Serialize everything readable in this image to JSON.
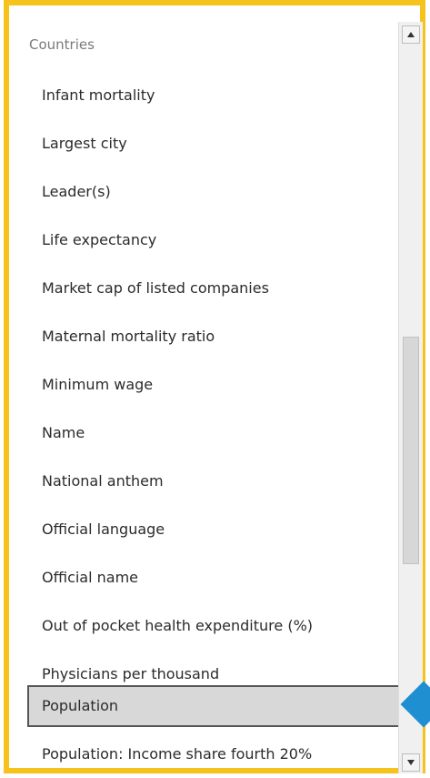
{
  "list": {
    "group_header": "Countries",
    "items": [
      "Infant mortality",
      "Largest city",
      "Leader(s)",
      "Life expectancy",
      "Market cap of listed companies",
      "Maternal mortality ratio",
      "Minimum wage",
      "Name",
      "National anthem",
      "Official language",
      "Official name",
      "Out of pocket health expenditure (%)",
      "Physicians per thousand",
      "Population",
      "Population: Income share fourth 20%"
    ],
    "selected": "Population"
  },
  "scrollbar": {
    "up_icon": "triangle-up-icon",
    "down_icon": "triangle-down-icon"
  },
  "colors": {
    "frame": "#f6c21c",
    "pointer": "#1f8fd1",
    "selected_bg": "#d8d8d8"
  }
}
